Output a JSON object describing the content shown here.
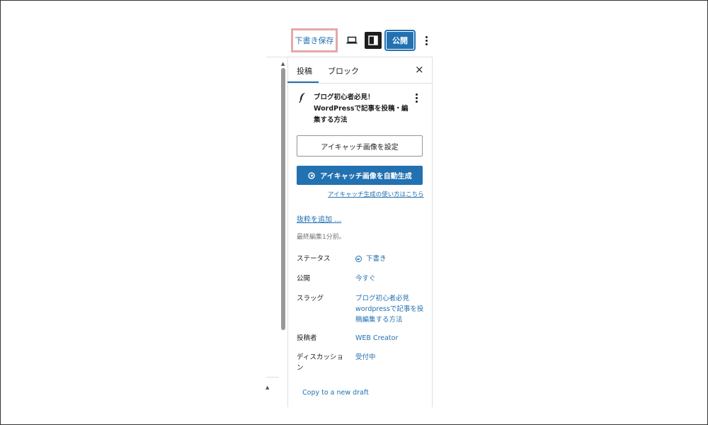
{
  "toolbar": {
    "save_draft_label": "下書き保存",
    "publish_label": "公開"
  },
  "sidebar": {
    "tabs": [
      {
        "label": "投稿"
      },
      {
        "label": "ブロック"
      }
    ],
    "close_label": "×",
    "post_title": "ブログ初心者必見！WordPressで記事を投稿・編集する方法",
    "set_featured_image_label": "アイキャッチ画像を設定",
    "auto_generate_label": "アイキャッチ画像を自動生成",
    "howto_link_label": "アイキャッチ生成の使い方はこちら",
    "add_excerpt_label": "抜粋を追加 …",
    "last_edited": "最終編集1分前。",
    "rows": [
      {
        "label": "ステータス",
        "value": "下書き"
      },
      {
        "label": "公開",
        "value": "今すぐ"
      },
      {
        "label": "スラッグ",
        "value": "ブログ初心者必見wordpressで記事を投稿編集する方法"
      },
      {
        "label": "投稿者",
        "value": "WEB Creator"
      },
      {
        "label": "ディスカッション",
        "value": "受付中"
      }
    ],
    "copy_draft_label": "Copy to a new draft"
  },
  "colors": {
    "accent": "#2271b1",
    "highlight_border": "#e5a8a8",
    "dark": "#1e1e1e"
  },
  "icons": [
    "preview-icon",
    "sidebar-toggle-icon",
    "more-options-icon",
    "feather-icon",
    "sparkle-icon",
    "status-draft-icon",
    "close-icon",
    "scroll-up-icon",
    "scroll-left-icon"
  ]
}
